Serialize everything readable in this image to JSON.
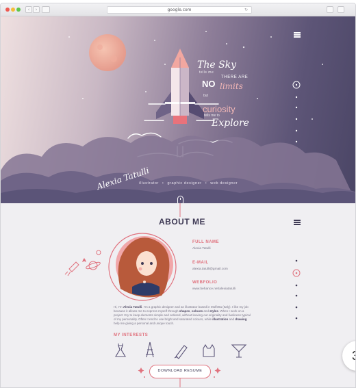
{
  "browser": {
    "url": "google.com",
    "back_glyph": "‹",
    "forward_glyph": "›",
    "reload_glyph": "↻"
  },
  "hero": {
    "tagline": {
      "line1": "The Sky",
      "line2": "tells me",
      "line3": "THERE ARE",
      "line4": "NO",
      "line5": "limits",
      "line6": "but",
      "line7": "curiosity",
      "line8": "tells me to",
      "line9": "Explore"
    },
    "signature": "Alexia Tatulli",
    "roles": [
      "illustrator",
      "graphic designer",
      "web designer"
    ],
    "menu_icon": "hamburger-icon",
    "scroll_icon": "mouse-scroll-icon"
  },
  "about": {
    "title": "ABOUT ME",
    "fields": [
      {
        "label": "FULL NAME",
        "value": "Alexia Tatulli"
      },
      {
        "label": "E-MAIL",
        "value": "alexia.tatulli@gmail.com"
      },
      {
        "label": "WEBFOLIO",
        "value": "www.behance.net/alexiatatulli"
      }
    ],
    "bio_parts": {
      "p1": "Hi, I'm ",
      "name": "Alexia Tatulli",
      "p2": ". I'm a graphic designer and an illustrator based in Molfetta (Italy). I like my job because it allows me to express myself through ",
      "b1": "shapes",
      "p3": ", ",
      "b2": "colours",
      "p4": " and ",
      "b3": "styles",
      "p5": ". When I work on a project I try to keep elements simple and ordered, without leaving out originality and liveliness typical of my personality. Often I tend to use bright and saturated colours, while ",
      "b4": "illustration",
      "p6": " and ",
      "b5": "drawing",
      "p7": " help me giving a personal and unique touch."
    },
    "interests_title": "MY INTERESTS",
    "interests": [
      "dress-icon",
      "eiffel-tower-icon",
      "pen-nib-icon",
      "cat-icon",
      "cocktail-icon"
    ],
    "download_label": "DOWNLOAD RESUME"
  },
  "colors": {
    "accent": "#e0717d",
    "dark": "#3f3a55",
    "hero_dark": "#4a4565",
    "hero_light": "#efe0e0"
  },
  "page_badge": "3"
}
